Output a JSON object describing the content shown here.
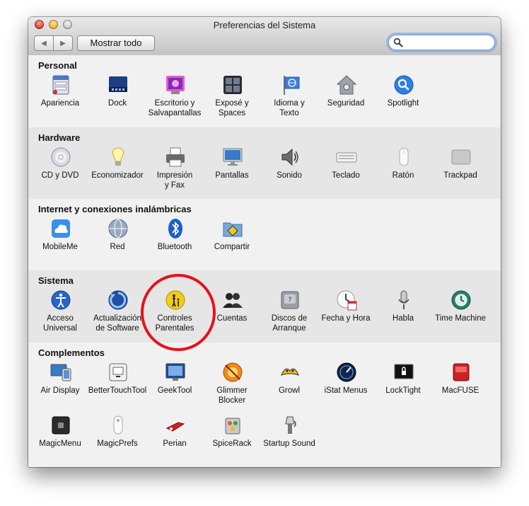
{
  "window": {
    "title": "Preferencias del Sistema",
    "show_all_label": "Mostrar todo",
    "search": {
      "value": "",
      "placeholder": ""
    },
    "back_glyph": "◀",
    "forward_glyph": "▶"
  },
  "sections": [
    {
      "title": "Personal",
      "items": [
        {
          "label": "Apariencia",
          "icon": "appearance-icon"
        },
        {
          "label": "Dock",
          "icon": "dock-icon"
        },
        {
          "label": "Escritorio y\nSalvapantallas",
          "icon": "desktop-screensaver-icon"
        },
        {
          "label": "Exposé y\nSpaces",
          "icon": "expose-spaces-icon"
        },
        {
          "label": "Idioma y\nTexto",
          "icon": "language-text-icon"
        },
        {
          "label": "Seguridad",
          "icon": "security-house-icon"
        },
        {
          "label": "Spotlight",
          "icon": "spotlight-icon"
        }
      ]
    },
    {
      "title": "Hardware",
      "items": [
        {
          "label": "CD y DVD",
          "icon": "cd-dvd-icon"
        },
        {
          "label": "Economizador",
          "icon": "lightbulb-icon"
        },
        {
          "label": "Impresión\ny Fax",
          "icon": "printer-icon"
        },
        {
          "label": "Pantallas",
          "icon": "display-icon"
        },
        {
          "label": "Sonido",
          "icon": "speaker-icon"
        },
        {
          "label": "Teclado",
          "icon": "keyboard-icon"
        },
        {
          "label": "Ratón",
          "icon": "mouse-icon"
        },
        {
          "label": "Trackpad",
          "icon": "trackpad-icon"
        }
      ]
    },
    {
      "title": "Internet y conexiones inalámbricas",
      "items": [
        {
          "label": "MobileMe",
          "icon": "mobileme-cloud-icon"
        },
        {
          "label": "Red",
          "icon": "network-globe-icon"
        },
        {
          "label": "Bluetooth",
          "icon": "bluetooth-icon"
        },
        {
          "label": "Compartir",
          "icon": "sharing-folder-icon"
        }
      ]
    },
    {
      "title": "Sistema",
      "items": [
        {
          "label": "Acceso\nUniversal",
          "icon": "universal-access-icon"
        },
        {
          "label": "Actualización\nde Software",
          "icon": "software-update-icon"
        },
        {
          "label": "Controles\nParentales",
          "icon": "parental-controls-icon"
        },
        {
          "label": "Cuentas",
          "icon": "accounts-icon"
        },
        {
          "label": "Discos de\nArranque",
          "icon": "startup-disk-icon"
        },
        {
          "label": "Fecha y Hora",
          "icon": "date-time-clock-icon"
        },
        {
          "label": "Habla",
          "icon": "microphone-icon"
        },
        {
          "label": "Time Machine",
          "icon": "time-machine-icon"
        }
      ]
    },
    {
      "title": "Complementos",
      "items": [
        {
          "label": "Air Display",
          "icon": "air-display-icon"
        },
        {
          "label": "BetterTouchTool",
          "icon": "bettertouchtool-icon"
        },
        {
          "label": "GeekTool",
          "icon": "geektool-icon"
        },
        {
          "label": "Glimmer\nBlocker",
          "icon": "glimmerblocker-icon"
        },
        {
          "label": "Growl",
          "icon": "growl-icon"
        },
        {
          "label": "iStat Menus",
          "icon": "istat-menus-icon"
        },
        {
          "label": "LockTight",
          "icon": "locktight-icon"
        },
        {
          "label": "MacFUSE",
          "icon": "macfuse-icon"
        },
        {
          "label": "MagicMenu",
          "icon": "magicmenu-icon"
        },
        {
          "label": "MagicPrefs",
          "icon": "magicprefs-icon"
        },
        {
          "label": "Perian",
          "icon": "perian-icon"
        },
        {
          "label": "SpiceRack",
          "icon": "spicerack-icon"
        },
        {
          "label": "Startup Sound",
          "icon": "startup-sound-icon"
        }
      ]
    }
  ],
  "annotation": {
    "color": "#e4131b",
    "target": "Controles Parentales"
  }
}
